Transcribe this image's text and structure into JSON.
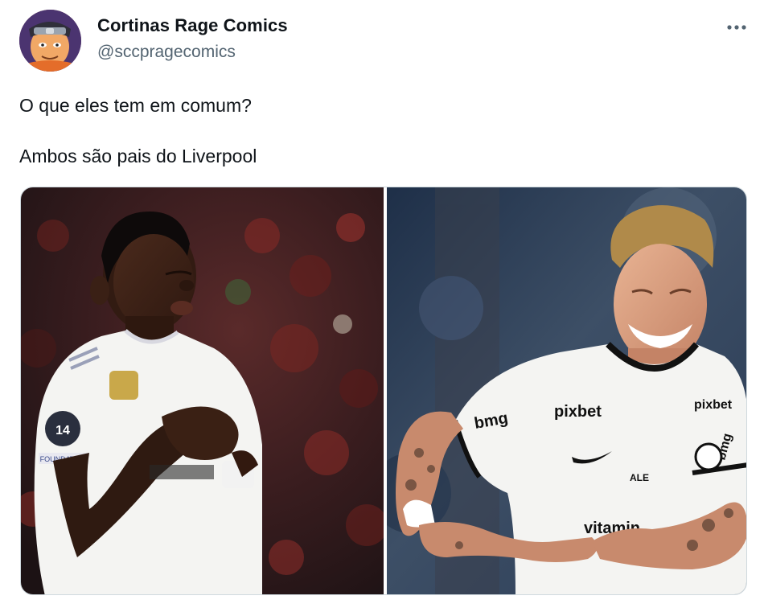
{
  "tweet": {
    "author": {
      "display_name": "Cortinas Rage Comics",
      "handle": "@sccpragecomics",
      "avatar_icon": "avatar-cartoon-ninja"
    },
    "more_icon": "more-horizontal-icon",
    "text_lines": [
      "O que eles tem em comum?",
      "Ambos são pais do Liverpool"
    ],
    "media": [
      {
        "kind": "photo",
        "description_icon": "player-photo-white-kit-red-crowd",
        "badge_texts": [
          "14",
          "FOUNDATION"
        ]
      },
      {
        "kind": "photo",
        "description_icon": "player-photo-white-kit-celebrating",
        "sponsor_texts": [
          "pixbet",
          "bmg",
          "pixbet",
          "bmg",
          "ALE",
          "vitamin"
        ]
      }
    ]
  },
  "colors": {
    "text_primary": "#0f1419",
    "text_secondary": "#536471",
    "border": "#cfd9de",
    "kit_white": "#f4f4f2"
  }
}
